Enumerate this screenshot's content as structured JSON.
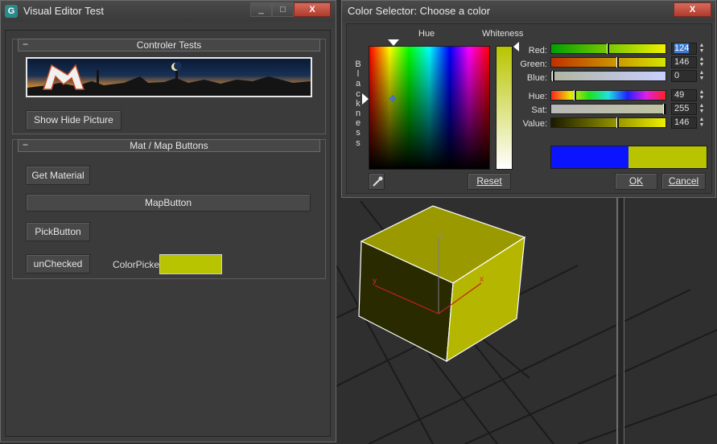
{
  "left_window": {
    "title": "Visual Editor Test",
    "buttons": [
      "_",
      "□",
      "X"
    ],
    "group1": {
      "title": "Controler Tests",
      "collapse": "−"
    },
    "show_hide_label": "Show Hide Picture",
    "group2": {
      "title": "Mat / Map Buttons",
      "collapse": "−"
    },
    "get_material_label": "Get Material",
    "map_button_label": "MapButton",
    "pick_button_label": "PickButton",
    "unchecked_label": "unChecked",
    "colorpicker_label": "ColorPicker",
    "colorpicker_color": "#b8c400"
  },
  "color_selector": {
    "title": "Color Selector: Choose a color",
    "close": "X",
    "hue_label": "Hue",
    "whiteness_label": "Whiteness",
    "blackness_label": "Blackness",
    "rows": [
      {
        "label": "Red:",
        "value": "124",
        "selected": true
      },
      {
        "label": "Green:",
        "value": "146",
        "selected": false
      },
      {
        "label": "Blue:",
        "value": "0",
        "selected": false
      },
      {
        "label": "Hue:",
        "value": "49",
        "selected": false
      },
      {
        "label": "Sat:",
        "value": "255",
        "selected": false
      },
      {
        "label": "Value:",
        "value": "146",
        "selected": false
      }
    ],
    "reset_label": "Reset",
    "ok_label": "OK",
    "cancel_label": "Cancel",
    "old_color": "#0a14ff",
    "new_color": "#b8c400"
  },
  "viewport": {
    "axis_x": "x",
    "axis_y": "y",
    "axis_z": "z"
  }
}
